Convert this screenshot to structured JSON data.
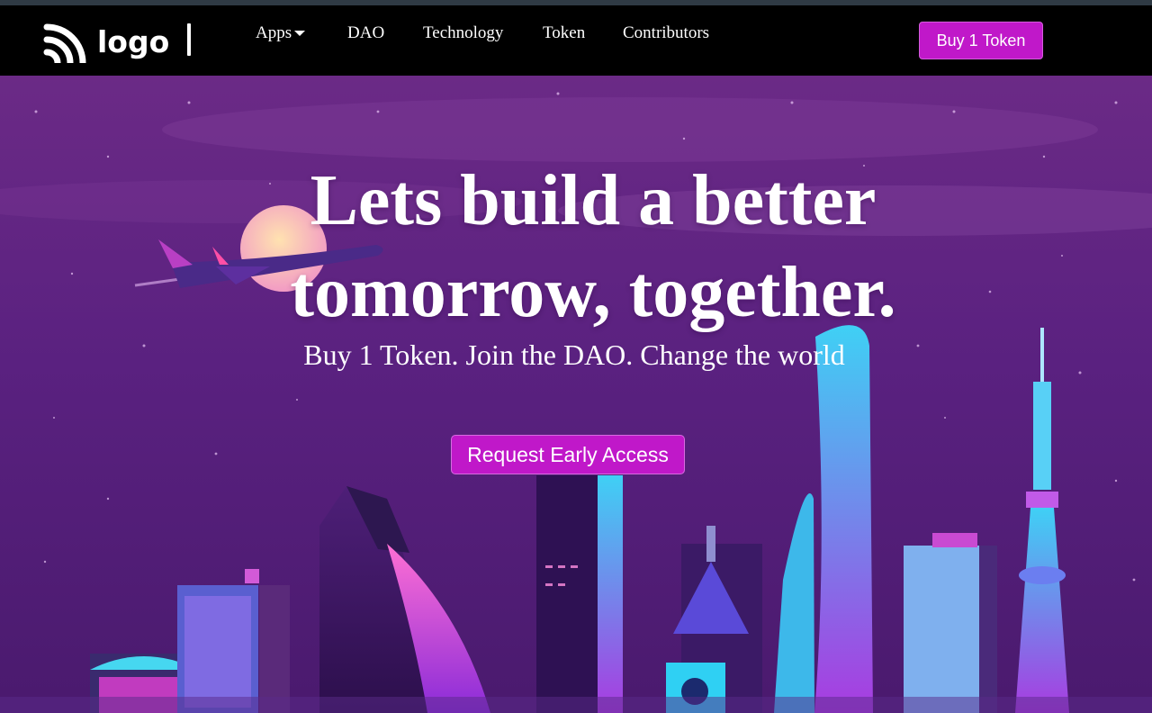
{
  "brand": {
    "logo_text": "logo",
    "logo_icon": "wifi-signal-icon"
  },
  "nav": {
    "items": [
      {
        "label": "Apps",
        "has_dropdown": true
      },
      {
        "label": "DAO"
      },
      {
        "label": "Technology"
      },
      {
        "label": "Token"
      },
      {
        "label": "Contributors"
      }
    ],
    "cta_label": "Buy 1 Token"
  },
  "hero": {
    "title_line1": "Lets build a better",
    "title_line2": "tomorrow, together.",
    "subtitle": "Buy 1 Token. Join the DAO. Change the world",
    "cta_label": "Request Early Access",
    "illustration": "neon-city-skyline-with-airplane"
  },
  "colors": {
    "accent": "#c018c9",
    "nav_bg": "#000000",
    "sky_top": "#6b2a86",
    "sky_bottom": "#4a1a6e"
  }
}
